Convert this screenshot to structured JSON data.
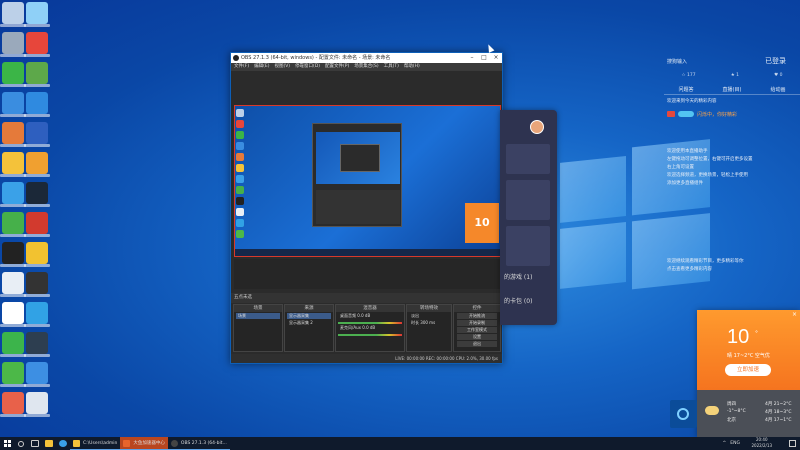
{
  "desktop": {
    "icons": [
      {
        "name": "this-pc-icon",
        "color": "#bcd0e8"
      },
      {
        "name": "network-icon",
        "color": "#8fd0f7"
      },
      {
        "name": "recycle-bin-icon",
        "color": "#9aa9bb"
      },
      {
        "name": "chrome-icon",
        "color": "#e7463b"
      },
      {
        "name": "security-shield-icon",
        "color": "#3bb547"
      },
      {
        "name": "user-app-icon",
        "color": "#5da84a"
      },
      {
        "name": "shield-blue-icon",
        "color": "#3a8de0"
      },
      {
        "name": "k-app-icon",
        "color": "#2f8ae0"
      },
      {
        "name": "tools-icon",
        "color": "#e57a3a"
      },
      {
        "name": "monitor-icon",
        "color": "#2e5fbf"
      },
      {
        "name": "folder-yellow-icon",
        "color": "#f4c23a"
      },
      {
        "name": "game-icon",
        "color": "#f0a030"
      },
      {
        "name": "chat-app-icon",
        "color": "#3aa1e8"
      },
      {
        "name": "steam-icon",
        "color": "#1b2838"
      },
      {
        "name": "puzzle-app-icon",
        "color": "#46b04a"
      },
      {
        "name": "netease-music-icon",
        "color": "#d23a2e"
      },
      {
        "name": "qq-icon",
        "color": "#222"
      },
      {
        "name": "video-app-icon",
        "color": "#f2c230"
      },
      {
        "name": "document-icon",
        "color": "#e8eef5"
      },
      {
        "name": "obs-icon",
        "color": "#333"
      },
      {
        "name": "phone-app-icon",
        "color": "#ffffff"
      },
      {
        "name": "browser-icon",
        "color": "#31a2e5"
      },
      {
        "name": "360-icon",
        "color": "#3cb44b"
      },
      {
        "name": "settings-app-icon",
        "color": "#2d3e50"
      },
      {
        "name": "speedup-icon",
        "color": "#4cb848"
      },
      {
        "name": "store-icon",
        "color": "#3d8fe3"
      },
      {
        "name": "colorful-app-icon",
        "color": "#e8614a"
      },
      {
        "name": "notepad-icon",
        "color": "#dfe6ef"
      }
    ]
  },
  "obs": {
    "title": "OBS 27.1.3 (64-bit, windows) - 配置文件: 未命名 - 场景: 未命名",
    "menu": [
      "文件(F)",
      "编辑(E)",
      "视图(V)",
      "停靠窗口(D)",
      "配置文件(P)",
      "场景集合(S)",
      "工具(T)",
      "帮助(H)"
    ],
    "preview_number": "10",
    "docks_title": "五点未选",
    "scenes": {
      "title": "场景",
      "items": [
        "场景"
      ]
    },
    "sources": {
      "title": "来源",
      "items": [
        "显示器采集",
        "显示器采集 2"
      ]
    },
    "mixer": {
      "title": "混音器",
      "items": [
        "桌面音频 0.0 dB",
        "麦克风/Aux 0.0 dB"
      ]
    },
    "transitions": {
      "title": "转场特效",
      "items": [
        "淡出",
        "时长 300 ms"
      ]
    },
    "controls": {
      "title": "控件",
      "buttons": [
        "开始推流",
        "开始录制",
        "工作室模式",
        "设置",
        "退出"
      ]
    },
    "status": "LIVE: 00:00:00   REC: 00:00:00   CPU: 2.0%, 30.00 fps"
  },
  "dark_app": {
    "lines": [
      "的游戏 (1)",
      "的卡包 (0)"
    ]
  },
  "right_panel": {
    "brand": "搜狗输入",
    "login": "已登录",
    "stats": [
      "☆ 177",
      "★ 1",
      "♥ 0"
    ],
    "tabs": [
      "问题答",
      "直播(目)",
      "给动画"
    ],
    "intro": "欢迎来到今天的精彩内容",
    "progress_label": "闪烁中，你好精彩",
    "paragraph1": [
      "欢迎使用本直播助手",
      "左键拖动可调整位置，右键可开启更多设置",
      "右上角可设置",
      "欢迎选择频道，更换场景，轻松上手使用",
      "添加更多直播组件"
    ],
    "paragraph2": [
      "欢迎继续观看精彩节目，更多精彩等你",
      "点击查看更多精彩内容"
    ]
  },
  "weather": {
    "temp": "10",
    "unit": "°",
    "condition": "晴 17~2°C 空气优",
    "button": "立即加速",
    "close": "×",
    "today": "周四",
    "today_range": "-1°~8°C",
    "location": "北京",
    "side": [
      "4月  21~2°C",
      "4月  18~3°C",
      "4月  17~1°C"
    ]
  },
  "taskbar": {
    "apps": [
      {
        "label": "C:\\Users\\admin",
        "color": "#f4c23a"
      },
      {
        "label": "大鱼加速器中心",
        "color": "#e8642c"
      },
      {
        "label": "OBS 27.1.3 (64-bit...",
        "color": "#444"
      }
    ],
    "tray": [
      "^",
      "ENG"
    ],
    "time": "20:40",
    "date": "2022/2/13"
  }
}
